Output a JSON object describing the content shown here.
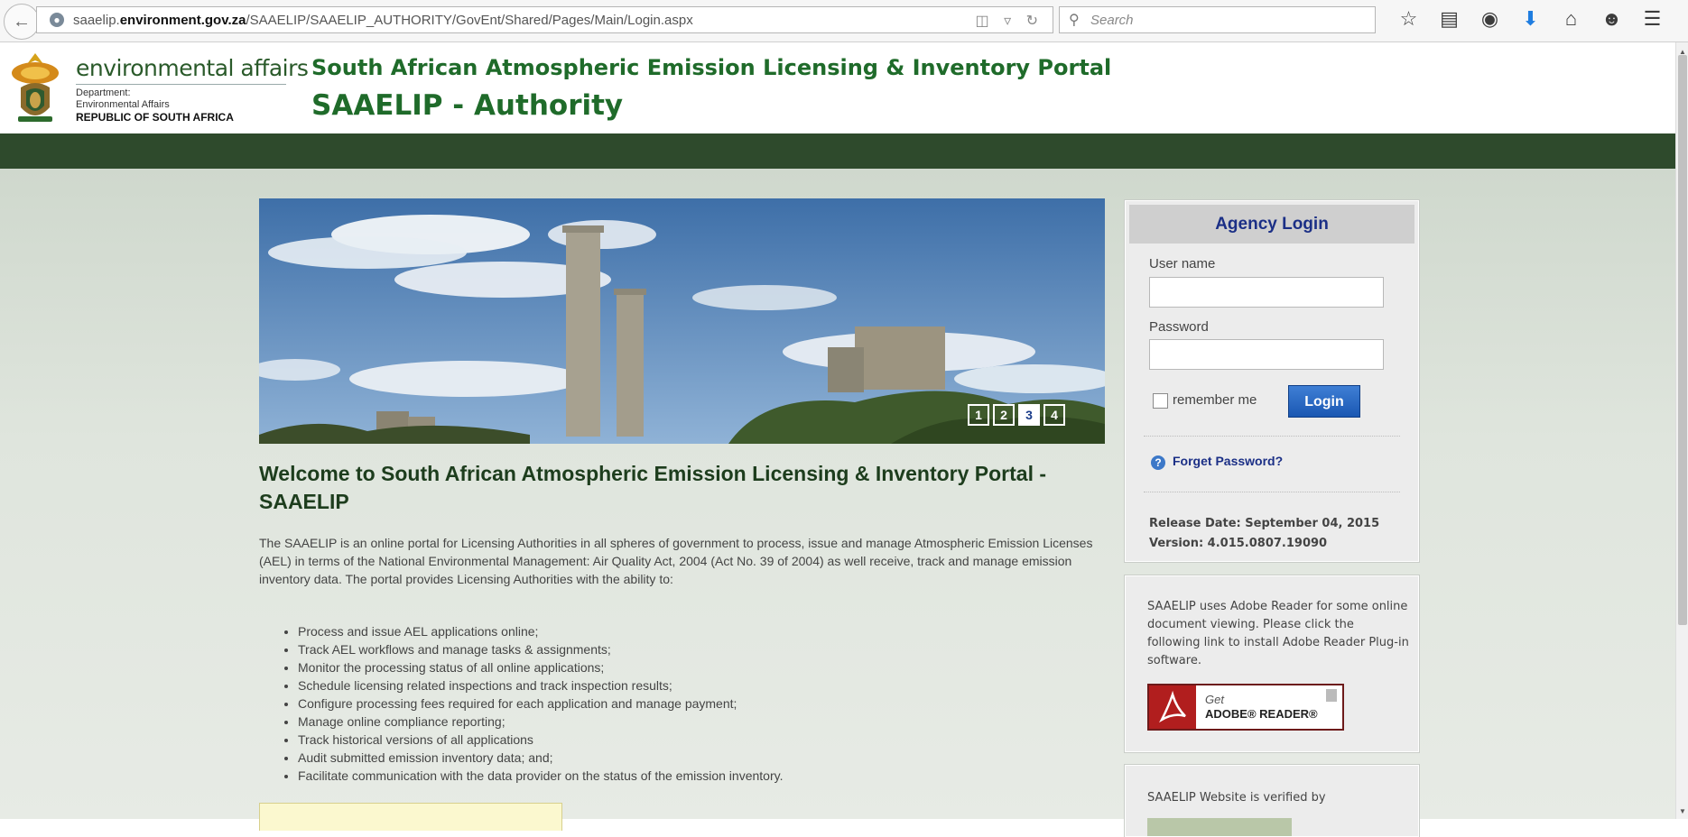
{
  "browser": {
    "url_host_prefix": "saaelip.",
    "url_host_bold": "environment.gov.za",
    "url_path": "/SAAELIP/SAAELIP_AUTHORITY/GovEnt/Shared/Pages/Main/Login.aspx",
    "search_placeholder": "Search"
  },
  "header": {
    "dept_title": "environmental affairs",
    "dept_line1": "Department:",
    "dept_line2": "Environmental Affairs",
    "dept_line3": "REPUBLIC OF SOUTH AFRICA",
    "portal_title": "South African Atmospheric Emission Licensing & Inventory Portal",
    "portal_subtitle": "SAAELIP - Authority"
  },
  "banner": {
    "pages": [
      "1",
      "2",
      "3",
      "4"
    ],
    "active_page": "3"
  },
  "main": {
    "welcome_title": "Welcome to South African Atmospheric Emission Licensing & Inventory Portal - SAAELIP",
    "intro": "The SAAELIP is an online portal for Licensing Authorities in all spheres of government to process, issue and manage Atmospheric Emission Licenses (AEL) in terms of the National Environmental Management: Air Quality Act, 2004 (Act No. 39 of 2004) as well receive, track and manage emission inventory data. The portal provides Licensing Authorities with the ability to:",
    "features": [
      "Process and issue AEL applications online;",
      "Track AEL workflows and manage tasks & assignments;",
      "Monitor the processing status of all online applications;",
      "Schedule licensing related inspections and track inspection results;",
      "Configure processing fees required for each application and manage payment;",
      "Manage online compliance reporting;",
      "Track historical versions of all applications",
      "Audit submitted emission inventory data; and;",
      "Facilitate communication with the data provider on the status of the emission inventory."
    ]
  },
  "login": {
    "title": "Agency Login",
    "username_label": "User name",
    "username_value": "",
    "password_label": "Password",
    "password_value": "",
    "remember_label": "remember me",
    "remember_checked": false,
    "login_button": "Login",
    "forget_link": "Forget Password?",
    "release_date": "Release Date:  September 04, 2015",
    "version": "Version:  4.015.0807.19090"
  },
  "adobe": {
    "text": "SAAELIP uses Adobe Reader for some online document viewing. Please click the following link to install Adobe Reader Plug-in software.",
    "button_get": "Get",
    "button_name": "ADOBE® READER®"
  },
  "verify": {
    "text": "SAAELIP Website is verified by"
  },
  "colors": {
    "header_green": "#1f6b2a",
    "nav_bar": "#2e4a2c",
    "link_blue": "#1b2f86",
    "login_button": "#1a57b2"
  }
}
